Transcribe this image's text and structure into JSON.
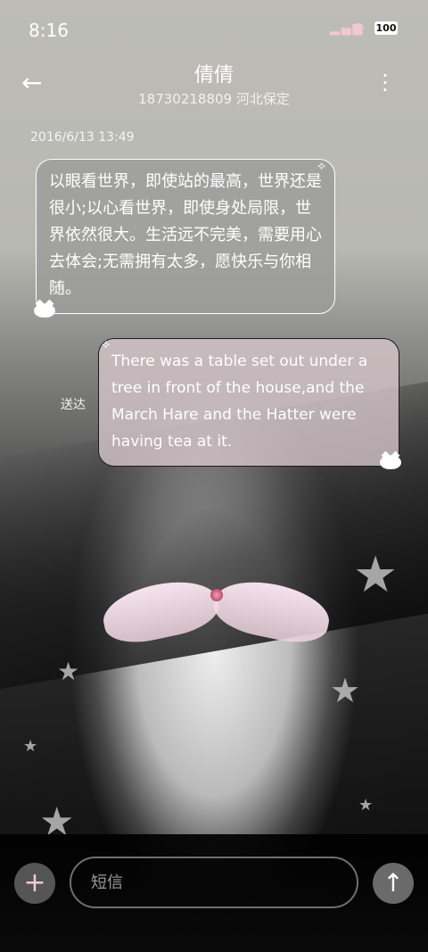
{
  "status_bar": {
    "time": "8:16",
    "battery": "100",
    "signal_icon": "signal-bars-icon",
    "wifi_icon": "wifi-icon",
    "accent_color": "#f2c7d5"
  },
  "header": {
    "title": "倩倩",
    "subtitle": "18730218809 河北保定"
  },
  "conversation": {
    "timestamp": "2016/6/13 13:49",
    "messages": [
      {
        "direction": "received",
        "text": "以眼看世界，即使站的最高，世界还是很小;以心看世界，即使身处局限，世界依然很大。生活远不完美，需要用心去体会;无需拥有太多，愿快乐与你相随。"
      },
      {
        "direction": "sent",
        "text": "There was a table set out under a tree in front of the house,and the March Hare and the Hatter were having tea at it.",
        "status": "送达"
      }
    ]
  },
  "composer": {
    "placeholder": "短信",
    "value": ""
  },
  "colors": {
    "received_bubble": "#9b9b9b",
    "sent_bubble": "#d7c8cd",
    "bottom_bar": "#0a0a0a"
  }
}
